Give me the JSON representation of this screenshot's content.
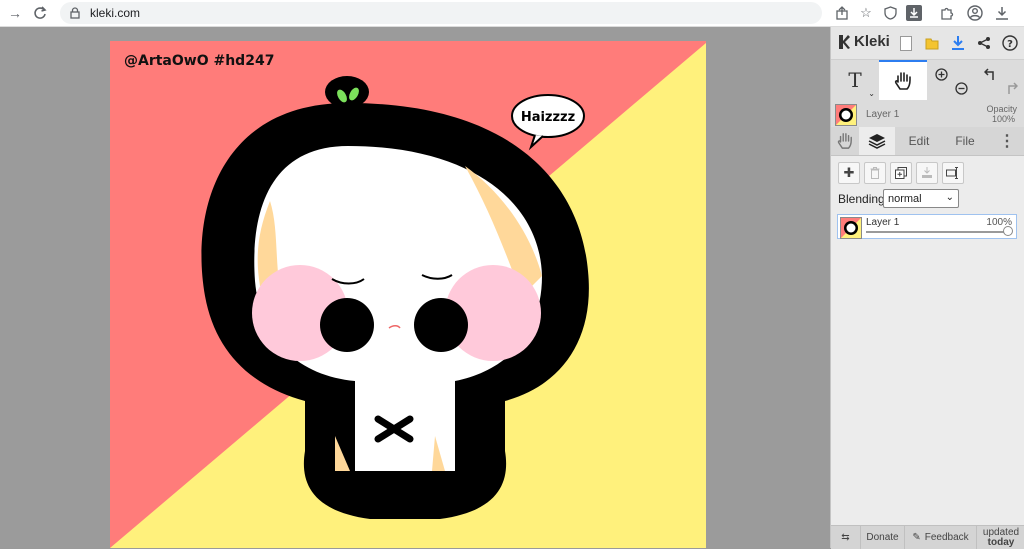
{
  "browser": {
    "url": "kleki.com",
    "icons": [
      "back-arrow-icon",
      "reload-icon",
      "lock-icon",
      "share-icon",
      "star-icon",
      "shield-icon",
      "download-arrow-icon",
      "puzzle-icon",
      "profile-icon",
      "download-icon"
    ]
  },
  "artwork": {
    "watermark": "@ArtaOwO #hd247",
    "speech": "Haizzzz",
    "colors": {
      "red": "#ff7c7a",
      "yellow": "#fff17c",
      "black": "#000000",
      "blush": "#ffc9da",
      "hair": "#ffd89a",
      "leaf": "#7be05b"
    }
  },
  "app": {
    "name": "Kleki",
    "accent": "#2c7df0",
    "tools": {
      "text_label": "T"
    },
    "layer_info": {
      "name": "Layer 1",
      "opacity_label": "Opacity",
      "opacity_value": "100%"
    },
    "tabs": {
      "edit": "Edit",
      "file": "File"
    },
    "layers": {
      "blending_label": "Blending",
      "blending_value": "normal",
      "items": [
        {
          "name": "Layer 1",
          "opacity": "100%"
        }
      ]
    },
    "footer": {
      "donate": "Donate",
      "feedback": "Feedback",
      "updated_line1": "updated",
      "updated_line2": "today"
    }
  }
}
